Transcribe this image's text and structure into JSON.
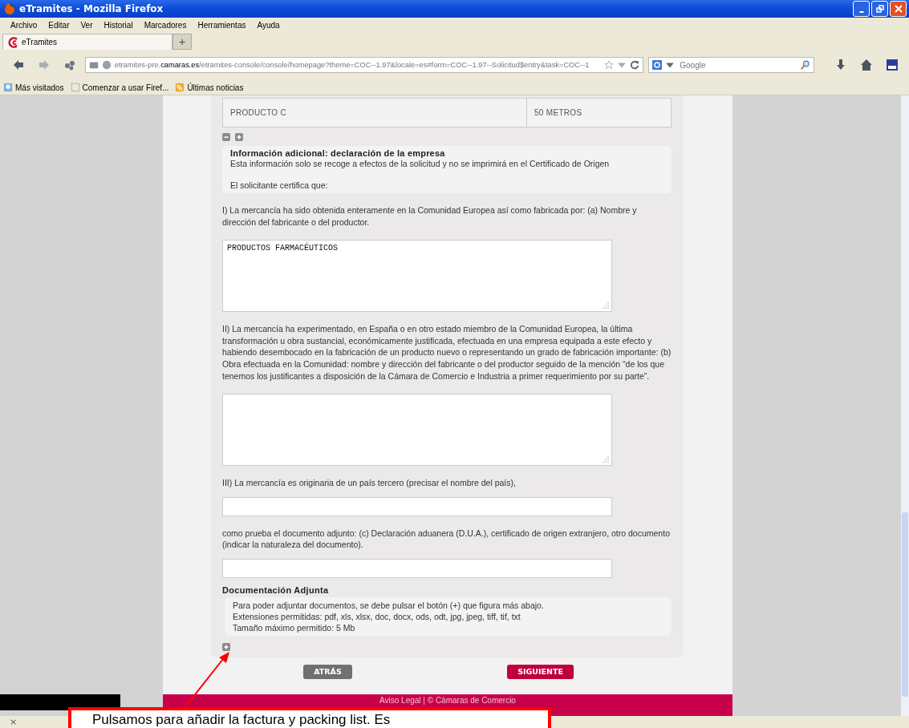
{
  "window": {
    "title": "eTramites - Mozilla Firefox"
  },
  "menu": [
    "Archivo",
    "Editar",
    "Ver",
    "Historial",
    "Marcadores",
    "Herramientas",
    "Ayuda"
  ],
  "tabs": [
    {
      "label": "eTramites",
      "selected": true
    }
  ],
  "new_tab": "+",
  "address": "etramites-pre.**camaras.es**/etramites-console/console/homepage?theme=COC--1.97&locale=es#form=COC--1.97--Solicitud$entry&task=COC--1",
  "search": {
    "placeholder": "Google"
  },
  "bookmarks": [
    "Más visitados",
    "Comenzar a usar Firef...",
    "Últimas noticias"
  ],
  "table": {
    "rows": [
      {
        "cells": [
          "PRODUCTO C",
          "50 METROS"
        ]
      }
    ]
  },
  "info": {
    "title": "Información adicional: declaración de la empresa",
    "lines": [
      "Esta información solo se recoge a efectos de la solicitud y no se imprimirá en el Certificado de Origen",
      "El solicitante certifica que:"
    ]
  },
  "questions": [
    {
      "text": "I) La mercancía ha sido obtenida enteramente en la Comunidad Europea así como fabricada por: (a) Nombre y dirección del fabricante o del productor.",
      "kind": "textarea",
      "value": "PRODUCTOS FARMACÉUTICOS"
    },
    {
      "text": "II) La mercancía ha experimentado, en España o en otro estado miembro de la Comunidad Europea, la última transformación u obra sustancial, económicamente justificada, efectuada en una empresa equipada a este efecto y habiendo desembocado en la fabricación de un producto nuevo o representando un grado de fabricación importante: (b) Obra efectuada en la Comunidad: nombre y dirección del fabricante o del productor seguido de la mención “de los que tenemos los justificantes a disposición de la Cámara de Comercio e Industria a primer requerimiento por su parte”.",
      "kind": "textarea"
    },
    {
      "text": "III) La mercancía es originaria de un país tercero (precisar el nombre del país),",
      "kind": "input"
    },
    {
      "text": "como prueba el documento adjunto: (c) Declaración aduanera (D.U.A.), certificado de origen extranjero, otro documento (indicar la naturaleza del documento).",
      "kind": "input"
    }
  ],
  "documents": {
    "title": "Documentación Adjunta",
    "lines": [
      "Para poder adjuntar documentos, se debe pulsar el botón (+) que figura más abajo.",
      "Extensiones permitidas: pdf, xls, xlsx, doc, docx, ods, odt, jpg, jpeg, tiff, tif, txt",
      "Tamaño máximo permitido: 5 Mb"
    ]
  },
  "buttons": [
    {
      "label": "ATRÁS",
      "kind": "secondary"
    },
    {
      "label": "SIGUIENTE",
      "kind": "primary"
    }
  ],
  "footer": "Aviso Legal | © Cámaras de Comercio",
  "callout": "Pulsamos para añadir la factura y packing list. Es",
  "status_bar": {
    "close": "×"
  }
}
